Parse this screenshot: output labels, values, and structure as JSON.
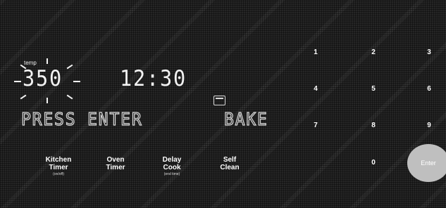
{
  "display": {
    "temp_label": "temp",
    "temperature": "350",
    "time": "12:30",
    "message": "PRESS ENTER",
    "mode": "BAKE"
  },
  "function_buttons": [
    {
      "label": "Kitchen\nTimer",
      "sub": "(on/off)"
    },
    {
      "label": "Oven\nTimer",
      "sub": ""
    },
    {
      "label": "Delay\nCook",
      "sub": "(end time)"
    },
    {
      "label": "Self\nClean",
      "sub": ""
    }
  ],
  "keypad": [
    "1",
    "2",
    "3",
    "4",
    "5",
    "6",
    "7",
    "8",
    "9",
    "0"
  ],
  "enter_label": "Enter",
  "colors": {
    "panel": "#262626",
    "text": "#ffffff",
    "enter_button": "#bfbfbf"
  }
}
